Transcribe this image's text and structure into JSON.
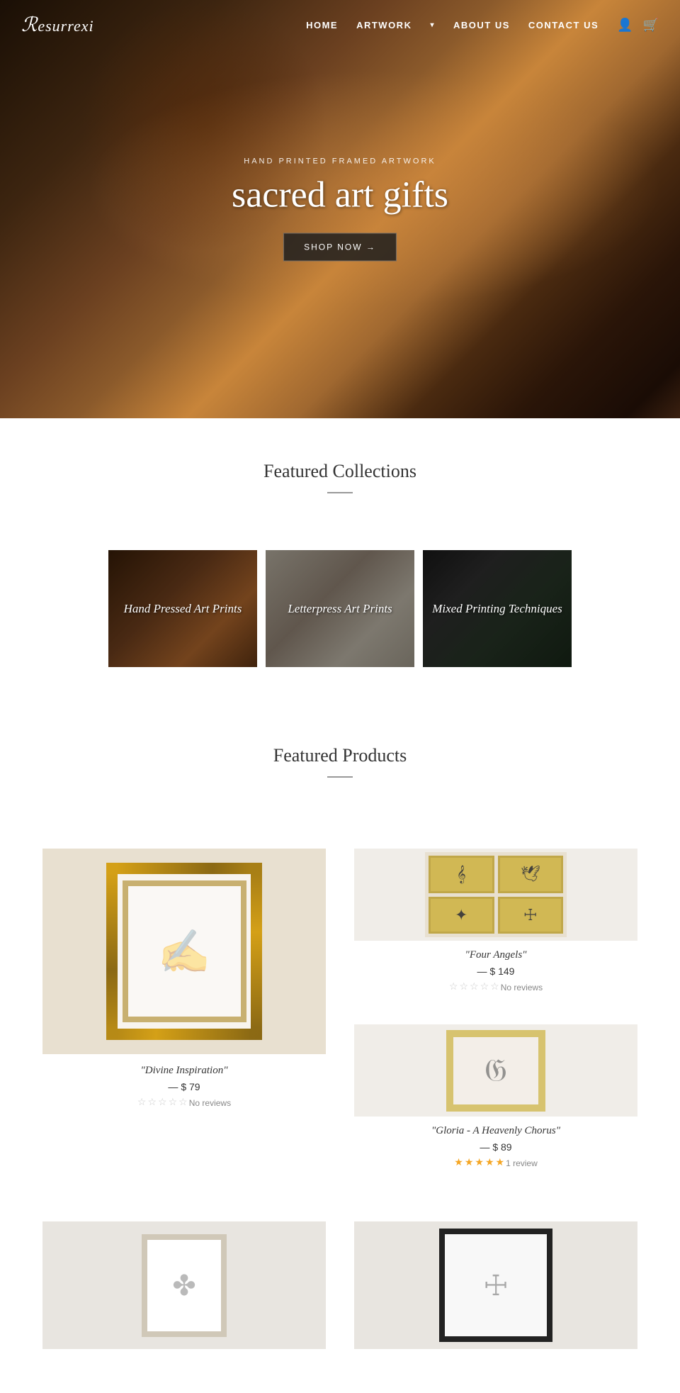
{
  "header": {
    "logo": "Resurrexi",
    "nav": {
      "home": "HOME",
      "artwork": "ARTWORK",
      "about_us": "ABOUT US",
      "contact_us": "CONTACT US"
    },
    "icons": {
      "account": "👤",
      "cart": "🛒"
    }
  },
  "hero": {
    "subtitle": "HAND PRINTED FRAMED ARTWORK",
    "title": "sacred art gifts",
    "cta_label": "SHOP NOW"
  },
  "featured_collections": {
    "section_title": "Featured Collections",
    "items": [
      {
        "label": "Hand Pressed Art Prints"
      },
      {
        "label": "Letterpress Art Prints"
      },
      {
        "label": "Mixed Printing Techniques"
      }
    ]
  },
  "featured_products": {
    "section_title": "Featured Products",
    "items": [
      {
        "name": "\"Divine Inspiration\"",
        "price": "$ 79",
        "reviews_count": "No reviews",
        "stars_filled": 0,
        "stars_total": 5
      },
      {
        "name": "\"Four Angels\"",
        "price": "$ 149",
        "reviews_count": "No reviews",
        "stars_filled": 0,
        "stars_total": 5
      },
      {
        "name": "\"Gloria - A Heavenly Chorus\"",
        "price": "$ 89",
        "reviews_count": "1 review",
        "stars_filled": 5,
        "stars_total": 5
      }
    ]
  },
  "bottom_products": [
    {
      "placeholder": "product-bottom-left"
    },
    {
      "placeholder": "product-bottom-right"
    }
  ]
}
